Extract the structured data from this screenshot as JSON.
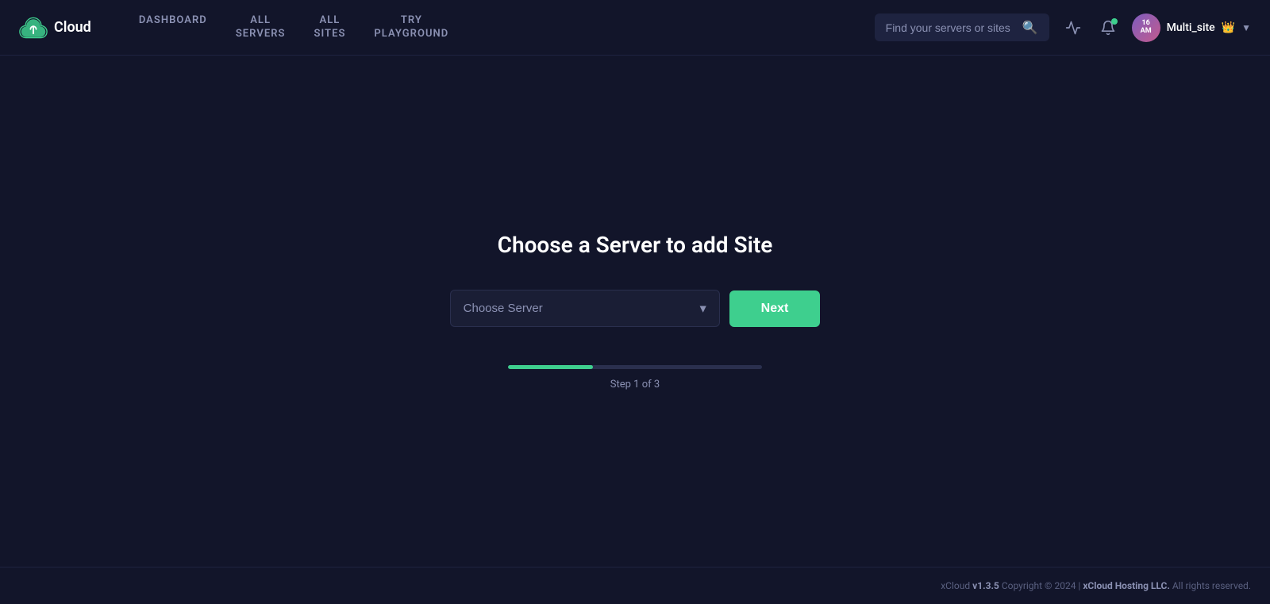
{
  "header": {
    "logo_text": "Cloud",
    "nav_items": [
      {
        "label": "DASHBOARD",
        "id": "dashboard"
      },
      {
        "label": "ALL\nSERVERS",
        "id": "all-servers"
      },
      {
        "label": "ALL\nSITES",
        "id": "all-sites"
      },
      {
        "label": "TRY\nPLAYGROUND",
        "id": "try-playground"
      }
    ],
    "search_placeholder": "Find your servers or sites",
    "user": {
      "initials": "16\nAM",
      "name": "Multi_site"
    }
  },
  "main": {
    "title": "Choose a Server to add Site",
    "select_placeholder": "Choose Server",
    "next_label": "Next",
    "step_label": "Step 1 of 3"
  },
  "footer": {
    "brand": "xCloud",
    "version": "v1.3.5",
    "copyright": "Copyright © 2024 |",
    "company": "xCloud Hosting LLC.",
    "rights": "All rights reserved."
  }
}
